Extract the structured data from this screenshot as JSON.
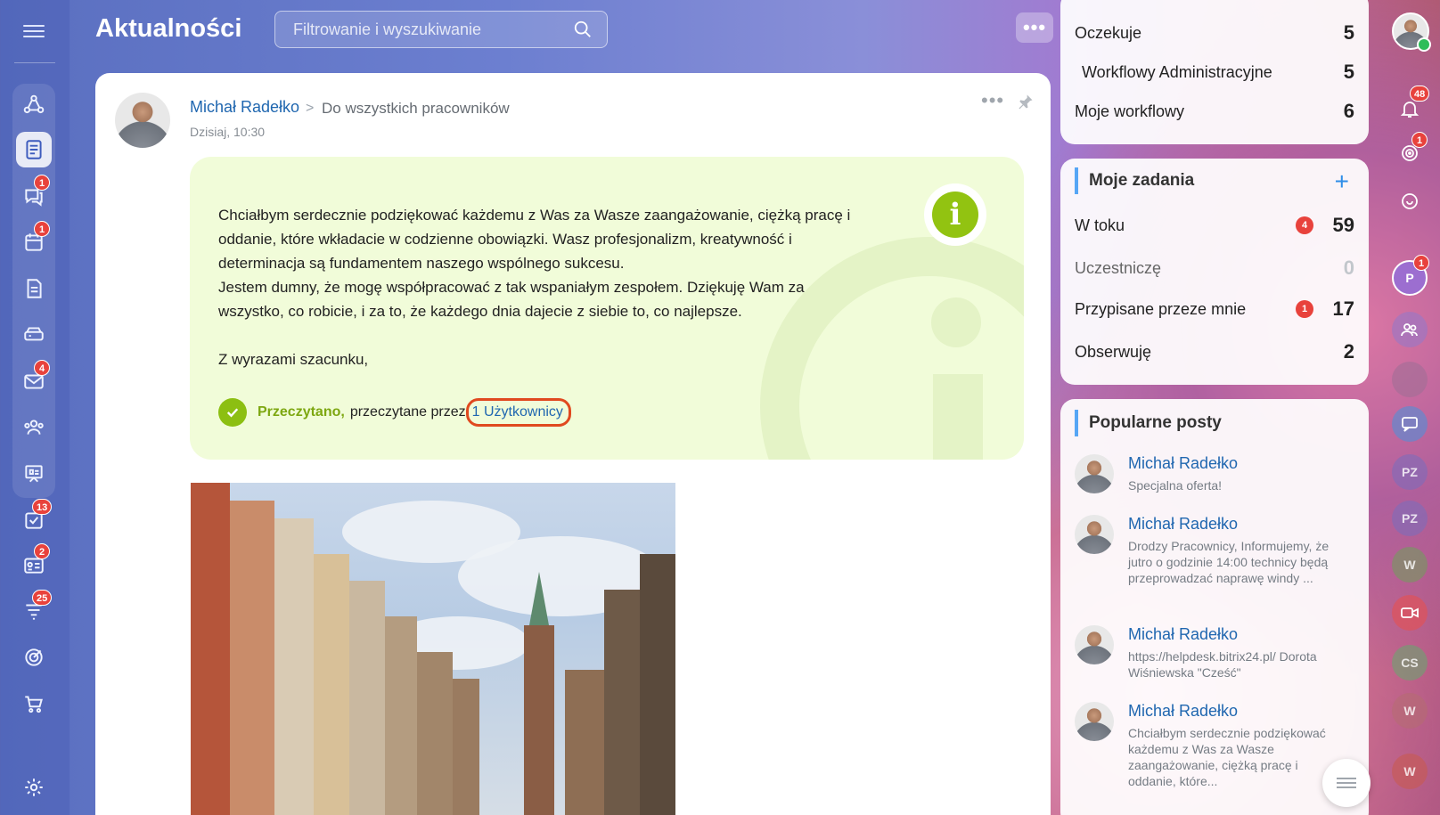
{
  "page": {
    "title": "Aktualności",
    "more": "•••"
  },
  "search": {
    "placeholder": "Filtrowanie i wyszukiwanie"
  },
  "nav_badges": {
    "messenger": "1",
    "calendar": "1",
    "mail": "4",
    "tasks": "13",
    "crm": "2",
    "feed": "25"
  },
  "post": {
    "author": "Michał Radełko",
    "chevron": ">",
    "destination": "Do wszystkich pracowników",
    "date": "Dzisiaj, 10:30",
    "menu": "•••",
    "info_icon": "i",
    "body": [
      "Chciałbym serdecznie podziękować każdemu z Was za Wasze zaangażowanie, ciężką pracę i oddanie, które wkładacie w codzienne obowiązki. Wasz profesjonalizm, kreatywność i determinacja są fundamentem naszego wspólnego sukcesu.",
      "Jestem dumny, że mogę współpracować z tak wspaniałym zespołem. Dziękuję Wam za wszystko, co robicie, i za to, że każdego dnia dajecie z siebie to, co najlepsze.",
      "Z wyrazami szacunku,"
    ],
    "read_label": "Przeczytano,",
    "read_by": "przeczytane przez",
    "read_link": "1 Użytkownicy"
  },
  "workflows": {
    "rows": [
      {
        "label": "Oczekuje",
        "count": "5"
      },
      {
        "label": "Workflowy Administracyjne",
        "count": "5"
      },
      {
        "label": "Moje workflowy",
        "count": "6"
      }
    ]
  },
  "tasks": {
    "title": "Moje zadania",
    "add": "+",
    "rows": [
      {
        "label": "W toku",
        "badge": "4",
        "count": "59"
      },
      {
        "label": "Uczestniczę",
        "badge": "",
        "count": "0"
      },
      {
        "label": "Przypisane przeze mnie",
        "badge": "1",
        "count": "17"
      },
      {
        "label": "Obserwuję",
        "badge": "",
        "count": "2"
      }
    ]
  },
  "popular": {
    "title": "Popularne posty",
    "posts": [
      {
        "author": "Michał Radełko",
        "text": "Specjalna oferta!"
      },
      {
        "author": "Michał Radełko",
        "text": "Drodzy Pracownicy, Informujemy, że jutro o godzinie 14:00 technicy będą przeprowadzać naprawę windy ..."
      },
      {
        "author": "Michał Radełko",
        "text": "https://helpdesk.bitrix24.pl/ Dorota Wiśniewska \"Cześć\""
      },
      {
        "author": "Michał Radełko",
        "text": "Chciałbym serdecznie podziękować każdemu z Was za Wasze zaangażowanie, ciężką pracę i oddanie, które..."
      }
    ]
  },
  "right": {
    "notif_badge": "48",
    "goals_badge": "1",
    "chat_p": "P",
    "chat_p_badge": "1",
    "pz1": "PZ",
    "pz2": "PZ",
    "w1": "W",
    "cs": "CS",
    "w2": "W",
    "w3": "W"
  }
}
